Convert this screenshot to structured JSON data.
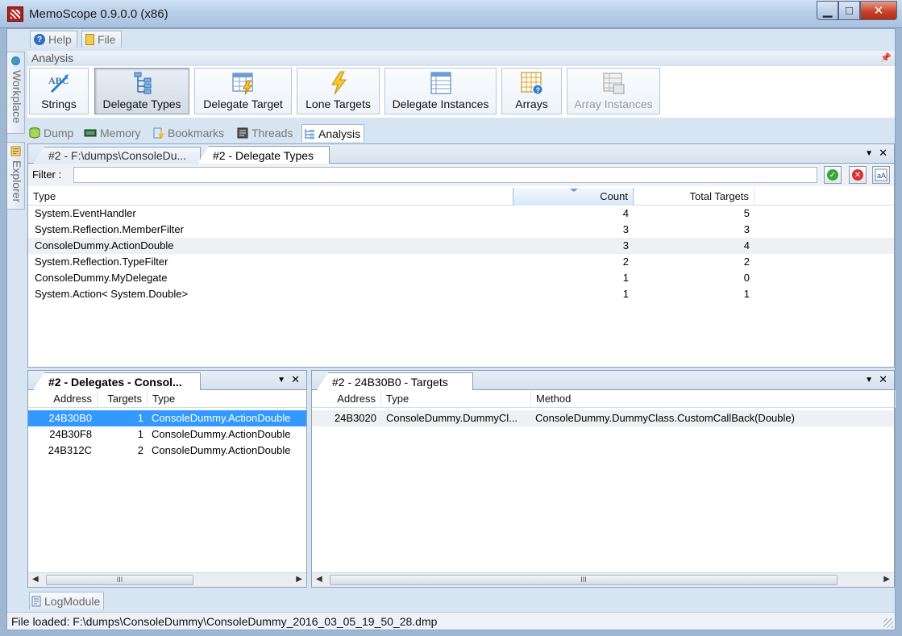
{
  "window": {
    "title": "MemoScope 0.9.0.0 (x86)"
  },
  "menu": {
    "help": "Help",
    "file": "File"
  },
  "side_tabs": {
    "workplace": "Workplace",
    "explorer": "Explorer"
  },
  "analysis_panel": {
    "title": "Analysis",
    "buttons": [
      {
        "label": "Strings",
        "icon": "abc-text-icon",
        "state": "normal"
      },
      {
        "label": "Delegate Types",
        "icon": "tree-hierarchy-icon",
        "state": "active"
      },
      {
        "label": "Delegate Target",
        "icon": "table-bolt-icon",
        "state": "normal"
      },
      {
        "label": "Lone Targets",
        "icon": "lightning-bolt-icon",
        "state": "normal"
      },
      {
        "label": "Delegate Instances",
        "icon": "list-grid-icon",
        "state": "normal"
      },
      {
        "label": "Arrays",
        "icon": "grid-query-icon",
        "state": "normal"
      },
      {
        "label": "Array Instances",
        "icon": "grid-list-icon",
        "state": "disabled"
      }
    ]
  },
  "module_tabs": [
    {
      "label": "Dump",
      "icon": "database-icon"
    },
    {
      "label": "Memory",
      "icon": "memory-chip-icon"
    },
    {
      "label": "Bookmarks",
      "icon": "bookmark-star-icon"
    },
    {
      "label": "Threads",
      "icon": "threads-icon"
    },
    {
      "label": "Analysis",
      "icon": "analysis-tree-icon",
      "active": true
    }
  ],
  "document_tabs": [
    {
      "label": "#2 - F:\\dumps\\ConsoleDu..."
    },
    {
      "label": "#2 - Delegate Types",
      "active": true
    }
  ],
  "filter": {
    "label": "Filter :",
    "value": ""
  },
  "delegate_types": {
    "columns": [
      "Type",
      "Count",
      "Total Targets"
    ],
    "rows": [
      {
        "type": "System.EventHandler",
        "count": "4",
        "total": "5"
      },
      {
        "type": "System.Reflection.MemberFilter",
        "count": "3",
        "total": "3"
      },
      {
        "type": "ConsoleDummy.ActionDouble",
        "count": "3",
        "total": "4"
      },
      {
        "type": "System.Reflection.TypeFilter",
        "count": "2",
        "total": "2"
      },
      {
        "type": "ConsoleDummy.MyDelegate",
        "count": "1",
        "total": "0"
      },
      {
        "type": "System.Action< System.Double>",
        "count": "1",
        "total": "1"
      }
    ]
  },
  "delegates_pane": {
    "tab": "#2 - Delegates - Consol...",
    "columns": [
      "Address",
      "Targets",
      "Type"
    ],
    "rows": [
      {
        "address": "24B30B0",
        "targets": "1",
        "type": "ConsoleDummy.ActionDouble"
      },
      {
        "address": "24B30F8",
        "targets": "1",
        "type": "ConsoleDummy.ActionDouble"
      },
      {
        "address": "24B312C",
        "targets": "2",
        "type": "ConsoleDummy.ActionDouble"
      }
    ]
  },
  "targets_pane": {
    "tab": "#2 - 24B30B0 - Targets",
    "columns": [
      "Address",
      "Type",
      "Method"
    ],
    "rows": [
      {
        "address": "24B3020",
        "type": "ConsoleDummy.DummyCl...",
        "method": "ConsoleDummy.DummyClass.CustomCallBack(Double)"
      }
    ]
  },
  "scroll_thumb": "III",
  "log_tab": "LogModule",
  "status": "File loaded: F:\\dumps\\ConsoleDummy\\ConsoleDummy_2016_03_05_19_50_28.dmp"
}
